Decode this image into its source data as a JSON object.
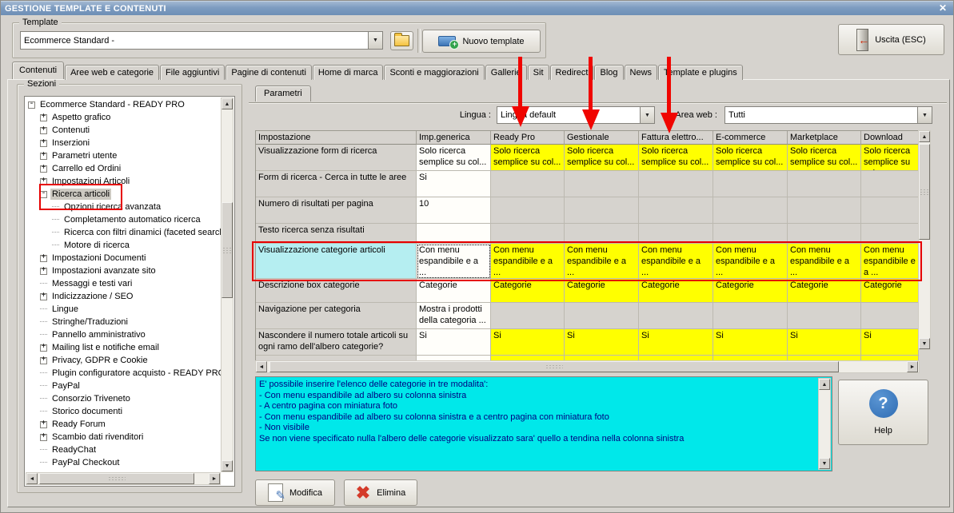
{
  "window": {
    "title": "GESTIONE TEMPLATE E CONTENUTI",
    "close_glyph": "✕"
  },
  "template_section": {
    "label": "Template",
    "combo_value": "Ecommerce Standard -",
    "new_template_label": "Nuovo template",
    "exit_label": "Uscita (ESC)"
  },
  "tabs": {
    "active": "Contenuti",
    "items": [
      "Contenuti",
      "Aree web e categorie",
      "File aggiuntivi",
      "Pagine di contenuti",
      "Home di marca",
      "Sconti e maggiorazioni",
      "Gallerie",
      "Sit",
      "Redirect",
      "Blog",
      "News",
      "Template e plugins"
    ]
  },
  "sezioni": {
    "label": "Sezioni",
    "tree": [
      {
        "label": "Ecommerce Standard - READY PRO",
        "glyph": "-",
        "level": 0
      },
      {
        "label": "Aspetto grafico",
        "glyph": "+",
        "level": 1
      },
      {
        "label": "Contenuti",
        "glyph": "+",
        "level": 1
      },
      {
        "label": "Inserzioni",
        "glyph": "+",
        "level": 1
      },
      {
        "label": "Parametri utente",
        "glyph": "+",
        "level": 1
      },
      {
        "label": "Carrello ed Ordini",
        "glyph": "+",
        "level": 1
      },
      {
        "label": "Impostazioni Articoli",
        "glyph": "+",
        "level": 1
      },
      {
        "label": "Ricerca articoli",
        "glyph": "-",
        "level": 1,
        "selected": true,
        "annotated": true
      },
      {
        "label": "Opzioni ricerca avanzata",
        "glyph": "",
        "level": 2
      },
      {
        "label": "Completamento automatico ricerca",
        "glyph": "",
        "level": 2
      },
      {
        "label": "Ricerca con filtri dinamici (faceted search)",
        "glyph": "",
        "level": 2
      },
      {
        "label": "Motore di ricerca",
        "glyph": "",
        "level": 2
      },
      {
        "label": "Impostazioni Documenti",
        "glyph": "+",
        "level": 1
      },
      {
        "label": "Impostazioni avanzate sito",
        "glyph": "+",
        "level": 1
      },
      {
        "label": "Messaggi e testi vari",
        "glyph": "",
        "level": 1
      },
      {
        "label": "Indicizzazione / SEO",
        "glyph": "+",
        "level": 1
      },
      {
        "label": "Lingue",
        "glyph": "",
        "level": 1
      },
      {
        "label": "Stringhe/Traduzioni",
        "glyph": "",
        "level": 1
      },
      {
        "label": "Pannello amministrativo",
        "glyph": "",
        "level": 1
      },
      {
        "label": "Mailing list e notifiche email",
        "glyph": "+",
        "level": 1
      },
      {
        "label": "Privacy, GDPR e Cookie",
        "glyph": "+",
        "level": 1
      },
      {
        "label": "Plugin configuratore acquisto - READY PRO",
        "glyph": "",
        "level": 1
      },
      {
        "label": "PayPal",
        "glyph": "",
        "level": 1
      },
      {
        "label": "Consorzio Triveneto",
        "glyph": "",
        "level": 1
      },
      {
        "label": "Storico documenti",
        "glyph": "",
        "level": 1
      },
      {
        "label": "Ready Forum",
        "glyph": "+",
        "level": 1
      },
      {
        "label": "Scambio dati rivenditori",
        "glyph": "+",
        "level": 1
      },
      {
        "label": "ReadyChat",
        "glyph": "",
        "level": 1
      },
      {
        "label": "PayPal Checkout",
        "glyph": "",
        "level": 1
      }
    ]
  },
  "parametri": {
    "tab_label": "Parametri",
    "lingua_label": "Lingua :",
    "lingua_value": "Lingua default",
    "area_web_label": "Area web :",
    "area_web_value": "Tutti"
  },
  "table": {
    "columns": [
      "Impostazione",
      "Imp.generica",
      "Ready Pro",
      "Gestionale",
      "Fattura elettro...",
      "E-commerce",
      "Marketplace",
      "Download"
    ],
    "rows": [
      {
        "impostazione": "Visualizzazione form di ricerca",
        "generica": "Solo ricerca semplice su col...",
        "area_values": "Solo ricerca semplice su col...",
        "yellow": true
      },
      {
        "impostazione": "Form di ricerca - Cerca in tutte le aree",
        "generica": "Si",
        "area_values": "",
        "yellow": false
      },
      {
        "impostazione": "Numero di risultati per pagina",
        "generica": "10",
        "area_values": "",
        "yellow": false
      },
      {
        "impostazione": "Testo ricerca senza risultati",
        "generica": "",
        "area_values": "",
        "yellow": false
      },
      {
        "impostazione": "Visualizzazione categorie articoli",
        "generica": "Con menu espandibile e a ...",
        "area_values": "Con menu espandibile e a ...",
        "yellow": true,
        "selected_row": true,
        "annotated": true
      },
      {
        "impostazione": "Descrizione box categorie",
        "generica": "Categorie",
        "area_values": "Categorie",
        "yellow": true
      },
      {
        "impostazione": "Navigazione per categoria",
        "generica": "Mostra i prodotti della categoria ...",
        "area_values": "",
        "yellow": false
      },
      {
        "impostazione": "Nascondere il numero totale articoli su ogni ramo dell'albero categorie?",
        "generica": "Si",
        "area_values": "Si",
        "yellow": true
      }
    ]
  },
  "info_box": {
    "lines": [
      "E' possibile inserire l'elenco delle categorie in tre modalita':",
      "- Con menu espandibile ad albero su colonna sinistra",
      "- A centro pagina con miniatura foto",
      "- Con menu espandibile ad albero su colonna sinistra e a centro pagina con miniatura foto",
      "- Non visibile",
      "Se non viene specificato nulla l'albero delle categorie visualizzato sara' quello a tendina nella colonna sinistra"
    ]
  },
  "actions": {
    "modifica": "Modifica",
    "elimina": "Elimina",
    "help": "Help"
  },
  "annotations": {
    "highlighted_tree_item": "Ricerca articoli",
    "highlighted_table_row": "Visualizzazione categorie articoli",
    "arrow_target_columns": [
      "Ready Pro",
      "Gestionale",
      "Fattura elettro..."
    ]
  },
  "colors": {
    "accent_yellow": "#ffff00",
    "row_highlight_cyan": "#b5eef1",
    "info_cyan": "#00e8ea",
    "annotation_red": "#e60000",
    "titlebar_blue": "#7d9cc0"
  }
}
